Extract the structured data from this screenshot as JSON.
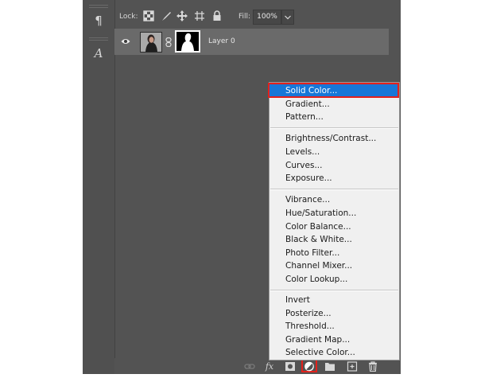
{
  "lockbar": {
    "lock_label": "Lock:",
    "fill_label": "Fill:",
    "fill_value": "100%"
  },
  "layer": {
    "name": "Layer 0"
  },
  "menu": {
    "items": [
      "Solid Color...",
      "Gradient...",
      "Pattern...",
      "Brightness/Contrast...",
      "Levels...",
      "Curves...",
      "Exposure...",
      "Vibrance...",
      "Hue/Saturation...",
      "Color Balance...",
      "Black & White...",
      "Photo Filter...",
      "Channel Mixer...",
      "Color Lookup...",
      "Invert",
      "Posterize...",
      "Threshold...",
      "Gradient Map...",
      "Selective Color..."
    ],
    "selected": "Solid Color..."
  },
  "bottom_bar": {
    "icons": [
      "link-layers-icon",
      "fx-icon",
      "add-mask-icon",
      "adjustment-layer-icon",
      "folder-icon",
      "new-layer-icon",
      "trash-icon"
    ],
    "fx_label": "fx"
  },
  "colors": {
    "panel": "#535353",
    "row": "#6a6a6a",
    "menu_bg": "#f0f0f0",
    "selected": "#1777d8",
    "highlight": "#e3211c"
  }
}
